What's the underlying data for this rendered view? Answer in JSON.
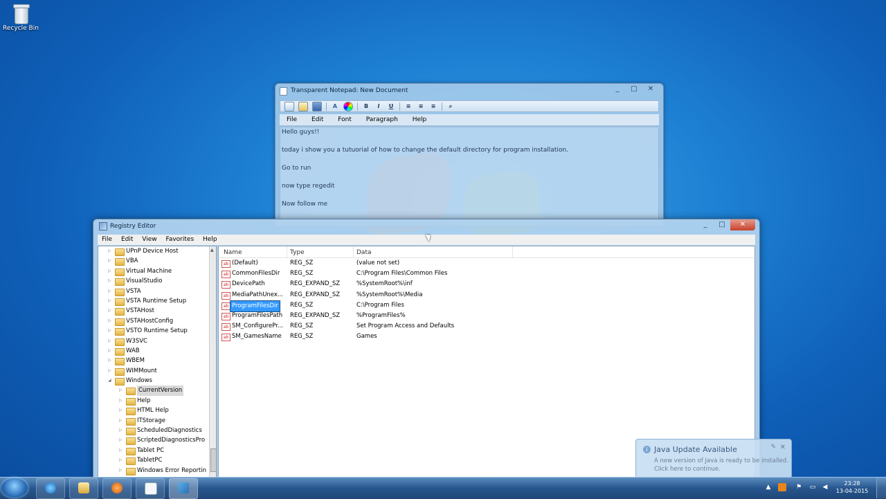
{
  "desktop": {
    "icons": [
      {
        "label": "Recycle Bin",
        "icon": "recycle-bin-icon"
      }
    ]
  },
  "notepad": {
    "title": "Transparent Notepad: New Document",
    "window_buttons": [
      "_",
      "□",
      "✕"
    ],
    "toolbar": {
      "icons": [
        "new-document-icon",
        "open-folder-icon",
        "save-icon",
        "font-icon",
        "color-wheel-icon",
        "bold-icon",
        "italic-icon",
        "underline-icon",
        "align-left-icon",
        "align-center-icon",
        "align-right-icon",
        "search-icon"
      ],
      "bold": "B",
      "italic": "I",
      "underline": "U"
    },
    "menu": [
      "File",
      "Edit",
      "Font",
      "Paragraph",
      "Help"
    ],
    "lines": [
      "Hello guys!!",
      "today i show you a tutuorial of how to change the default directory for program installation.",
      "Go to run",
      "now type regedit",
      "Now follow me"
    ]
  },
  "regedit": {
    "title": "Registry Editor",
    "window_buttons": [
      "_",
      "□",
      "✕"
    ],
    "menu": [
      "File",
      "Edit",
      "View",
      "Favorites",
      "Help"
    ],
    "tree": [
      {
        "label": "UPnP Device Host",
        "level": 0,
        "expander": "▷"
      },
      {
        "label": "VBA",
        "level": 0,
        "expander": "▷"
      },
      {
        "label": "Virtual Machine",
        "level": 0,
        "expander": "▷"
      },
      {
        "label": "VisualStudio",
        "level": 0,
        "expander": "▷"
      },
      {
        "label": "VSTA",
        "level": 0,
        "expander": "▷"
      },
      {
        "label": "VSTA Runtime Setup",
        "level": 0,
        "expander": "▷"
      },
      {
        "label": "VSTAHost",
        "level": 0,
        "expander": "▷"
      },
      {
        "label": "VSTAHostConfig",
        "level": 0,
        "expander": "▷"
      },
      {
        "label": "VSTO Runtime Setup",
        "level": 0,
        "expander": "▷"
      },
      {
        "label": "W3SVC",
        "level": 0,
        "expander": "▷"
      },
      {
        "label": "WAB",
        "level": 0,
        "expander": "▷"
      },
      {
        "label": "WBEM",
        "level": 0,
        "expander": "▷"
      },
      {
        "label": "WIMMount",
        "level": 0,
        "expander": "▷"
      },
      {
        "label": "Windows",
        "level": 0,
        "expander": "◢"
      },
      {
        "label": "CurrentVersion",
        "level": 1,
        "expander": "▷",
        "selected": true
      },
      {
        "label": "Help",
        "level": 1,
        "expander": "▷"
      },
      {
        "label": "HTML Help",
        "level": 1,
        "expander": "▷"
      },
      {
        "label": "ITStorage",
        "level": 1,
        "expander": "▷"
      },
      {
        "label": "ScheduledDiagnostics",
        "level": 1,
        "expander": "▷"
      },
      {
        "label": "ScriptedDiagnosticsPro",
        "level": 1,
        "expander": "▷"
      },
      {
        "label": "Tablet PC",
        "level": 1,
        "expander": "▷"
      },
      {
        "label": "TabletPC",
        "level": 1,
        "expander": "▷"
      },
      {
        "label": "Windows Error Reportin",
        "level": 1,
        "expander": "▷"
      }
    ],
    "columns": [
      "Name",
      "Type",
      "Data"
    ],
    "rows": [
      {
        "name": "(Default)",
        "type": "REG_SZ",
        "data": "(value not set)"
      },
      {
        "name": "CommonFilesDir",
        "type": "REG_SZ",
        "data": "C:\\Program Files\\Common Files"
      },
      {
        "name": "DevicePath",
        "type": "REG_EXPAND_SZ",
        "data": "%SystemRoot%\\inf"
      },
      {
        "name": "MediaPathUnex...",
        "type": "REG_EXPAND_SZ",
        "data": "%SystemRoot%\\Media"
      },
      {
        "name": "ProgramFilesDir",
        "type": "REG_SZ",
        "data": "C:\\Program Files",
        "selected": true
      },
      {
        "name": "ProgramFilesPath",
        "type": "REG_EXPAND_SZ",
        "data": "%ProgramFiles%"
      },
      {
        "name": "SM_ConfigurePr...",
        "type": "REG_SZ",
        "data": "Set Program Access and Defaults"
      },
      {
        "name": "SM_GamesName",
        "type": "REG_SZ",
        "data": "Games"
      }
    ],
    "value_icon_text": "ab"
  },
  "notification": {
    "title": "Java Update Available",
    "message": "A new version of Java is ready to be installed. Click here to continue.",
    "icon": "info-icon"
  },
  "taskbar": {
    "apps": [
      "internet-explorer-icon",
      "file-explorer-icon",
      "media-player-icon",
      "notepad-icon",
      "regedit-icon"
    ],
    "tray_icons": [
      "show-hidden-icons",
      "java-icon",
      "action-center-icon",
      "network-icon",
      "volume-icon"
    ],
    "time": "23:28",
    "date": "13-04-2015"
  }
}
